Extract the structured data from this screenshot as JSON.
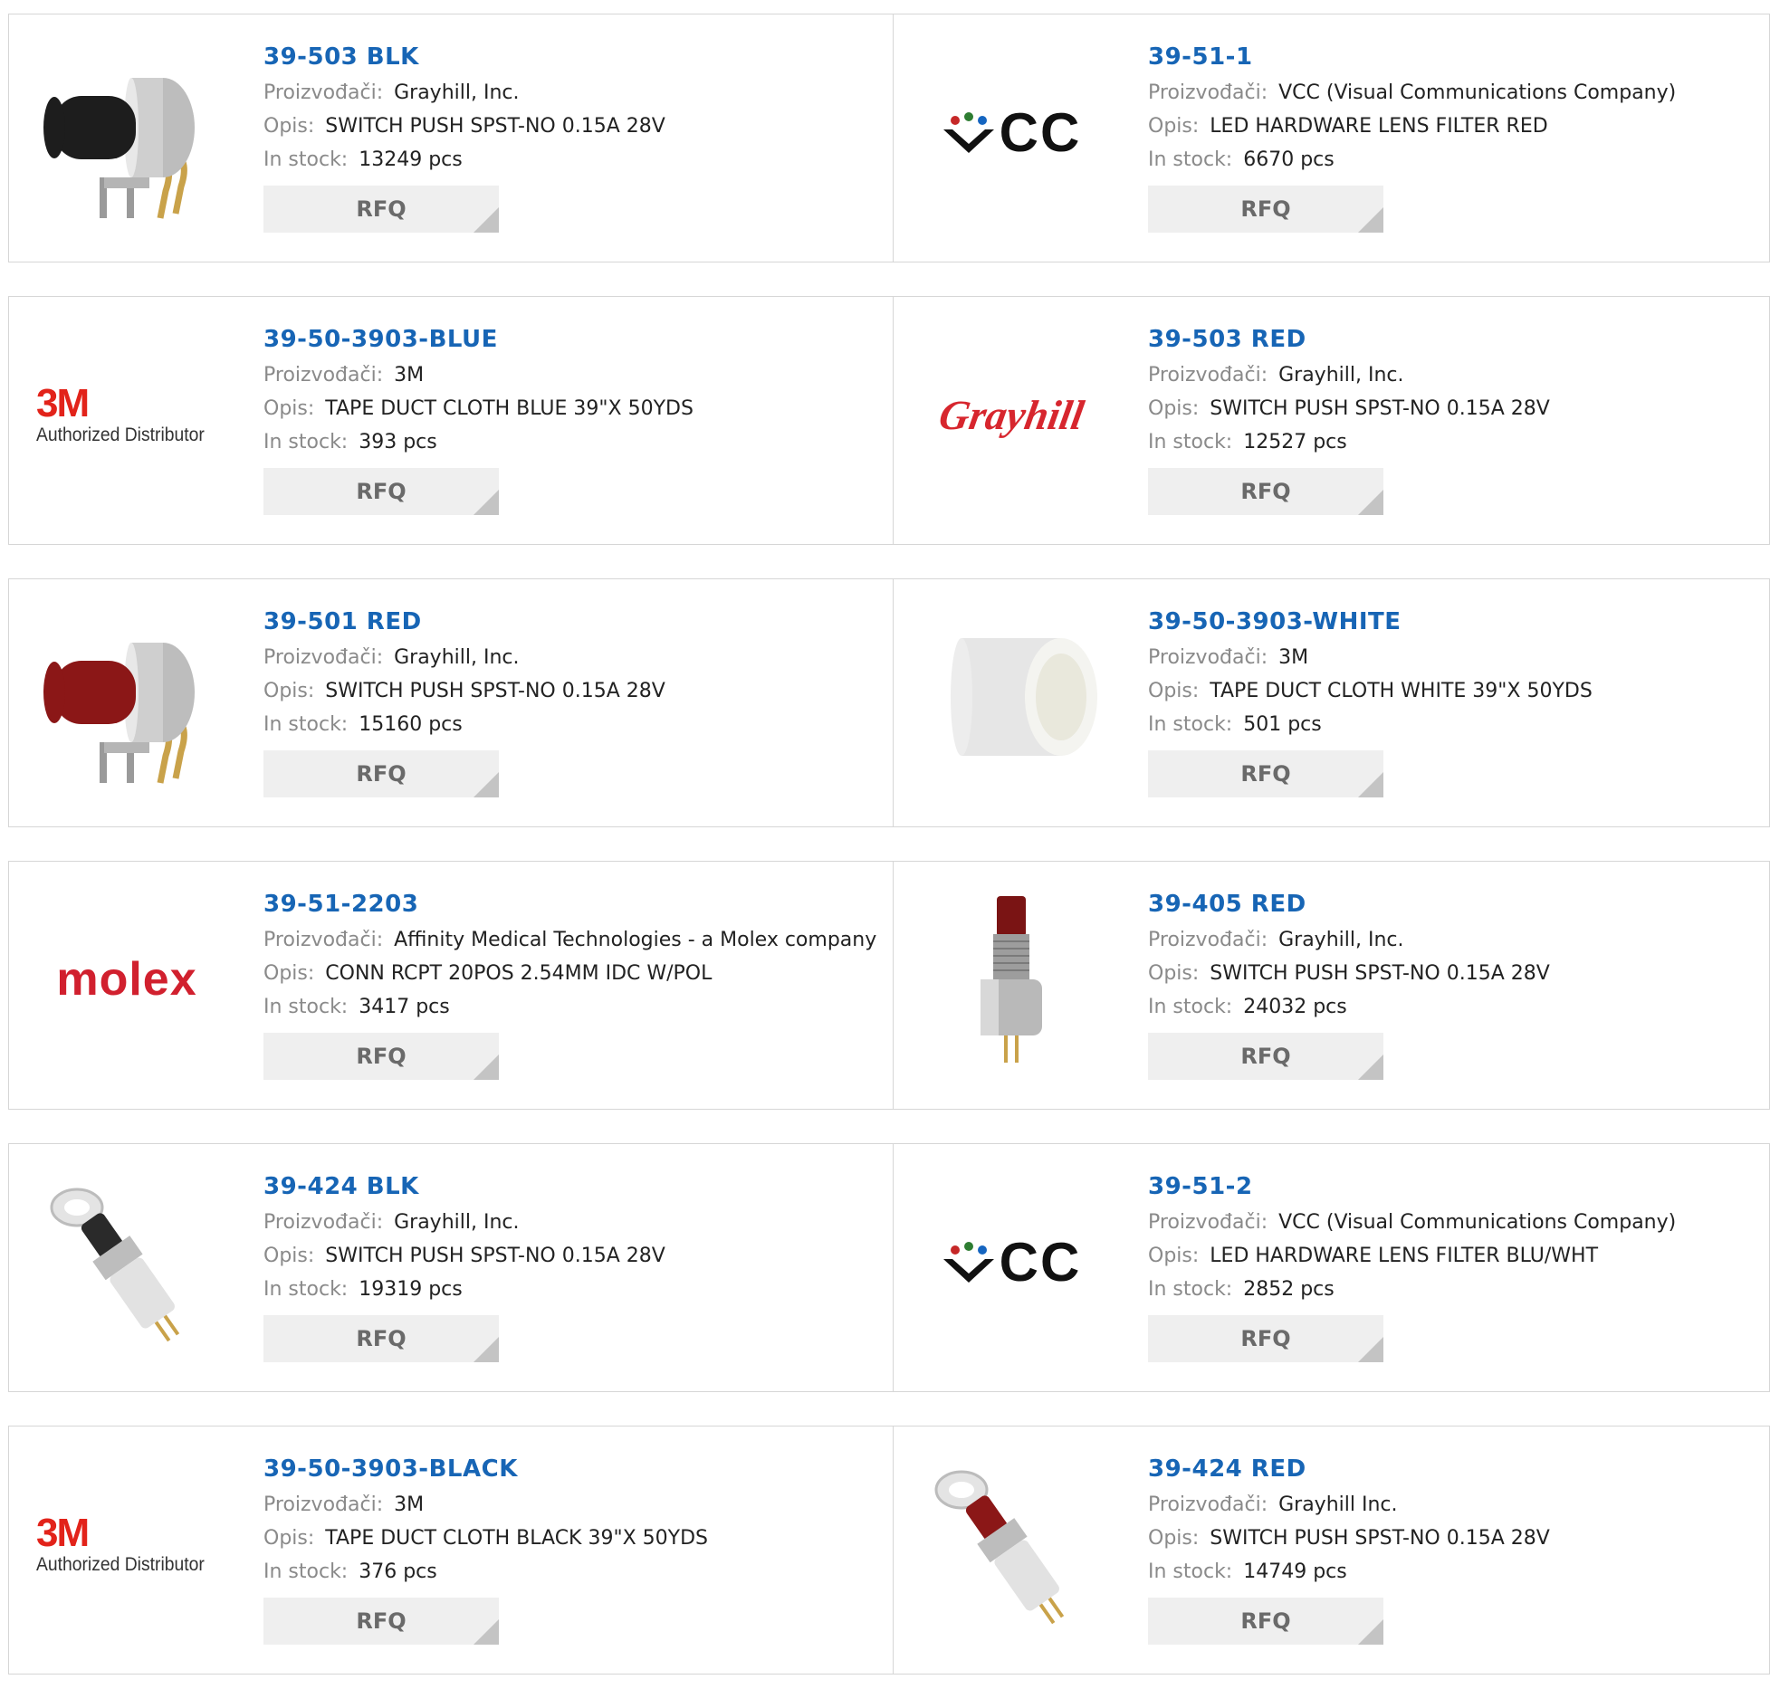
{
  "labels": {
    "manufacturer": "Proizvođači:",
    "description": "Opis:",
    "stock": "In stock:",
    "rfq": "RFQ"
  },
  "products": [
    {
      "part": "39-503 BLK",
      "manufacturer": "Grayhill, Inc.",
      "description": "SWITCH PUSH SPST-NO 0.15A 28V",
      "stock": "13249 pcs",
      "image": "switch-black-photo"
    },
    {
      "part": "39-51-1",
      "manufacturer": "VCC (Visual Communications Company)",
      "description": "LED HARDWARE LENS FILTER RED",
      "stock": "6670 pcs",
      "image": "vcc-logo"
    },
    {
      "part": "39-50-3903-BLUE",
      "manufacturer": "3M",
      "description": "TAPE DUCT CLOTH BLUE 39\"X 50YDS",
      "stock": "393 pcs",
      "image": "3m-logo"
    },
    {
      "part": "39-503 RED",
      "manufacturer": "Grayhill, Inc.",
      "description": "SWITCH PUSH SPST-NO 0.15A 28V",
      "stock": "12527 pcs",
      "image": "grayhill-logo"
    },
    {
      "part": "39-501 RED",
      "manufacturer": "Grayhill, Inc.",
      "description": "SWITCH PUSH SPST-NO 0.15A 28V",
      "stock": "15160 pcs",
      "image": "switch-red-photo"
    },
    {
      "part": "39-50-3903-WHITE",
      "manufacturer": "3M",
      "description": "TAPE DUCT CLOTH WHITE 39\"X 50YDS",
      "stock": "501 pcs",
      "image": "tape-white-photo"
    },
    {
      "part": "39-51-2203",
      "manufacturer": "Affinity Medical Technologies - a Molex company",
      "description": "CONN RCPT 20POS 2.54MM IDC W/POL",
      "stock": "3417 pcs",
      "image": "molex-logo"
    },
    {
      "part": "39-405 RED",
      "manufacturer": "Grayhill, Inc.",
      "description": "SWITCH PUSH SPST-NO 0.15A 28V",
      "stock": "24032 pcs",
      "image": "switch-red-pin-photo"
    },
    {
      "part": "39-424 BLK",
      "manufacturer": "Grayhill, Inc.",
      "description": "SWITCH PUSH SPST-NO 0.15A 28V",
      "stock": "19319 pcs",
      "image": "switch-black-nut-photo"
    },
    {
      "part": "39-51-2",
      "manufacturer": "VCC (Visual Communications Company)",
      "description": "LED HARDWARE LENS FILTER BLU/WHT",
      "stock": "2852 pcs",
      "image": "vcc-logo"
    },
    {
      "part": "39-50-3903-BLACK",
      "manufacturer": "3M",
      "description": "TAPE DUCT CLOTH BLACK 39\"X 50YDS",
      "stock": "376 pcs",
      "image": "3m-logo"
    },
    {
      "part": "39-424 RED",
      "manufacturer": "Grayhill Inc.",
      "description": "SWITCH PUSH SPST-NO 0.15A 28V",
      "stock": "14749 pcs",
      "image": "switch-red-nut-photo"
    }
  ],
  "logos": {
    "3m_big": "3M",
    "3m_small": "Authorized Distributor",
    "molex": "molex",
    "grayhill": "Grayhill",
    "vcc": "VCC"
  },
  "colors": {
    "part_link": "#1765b5",
    "label": "#8a8a8a",
    "rfq_bg": "#efefef",
    "border": "#d6d6d6"
  }
}
